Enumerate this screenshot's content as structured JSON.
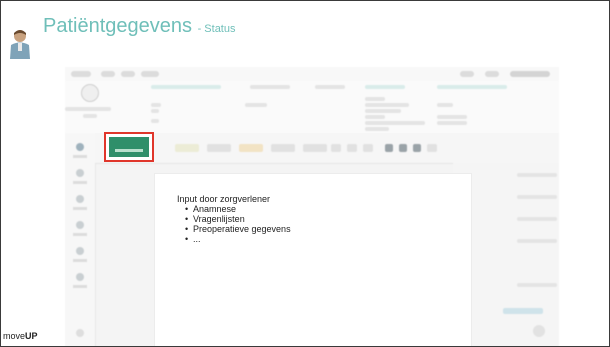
{
  "slide": {
    "title": "Patiëntgegevens",
    "subtitle": "- Status",
    "brand_prefix": "move",
    "brand_suffix": "UP"
  },
  "card": {
    "heading": "Input door zorgverlener",
    "items": [
      "Anamnese",
      "Vragenlijsten",
      "Preoperatieve gegevens",
      "..."
    ]
  },
  "colors": {
    "title": "#6fbfb9",
    "highlight_border": "#e0362b",
    "status_button": "#2f8f6a"
  }
}
